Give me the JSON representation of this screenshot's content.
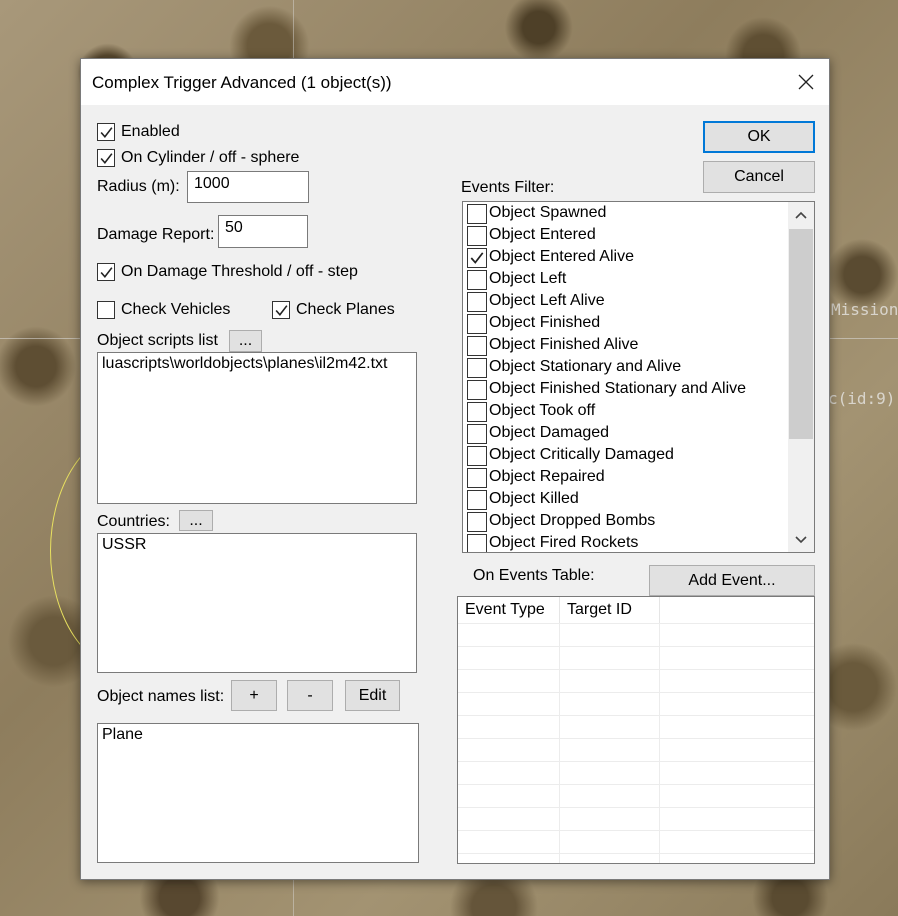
{
  "map": {
    "label_mission": "Mission",
    "label_id": "c(id:9)"
  },
  "dialog": {
    "title": "Complex Trigger Advanced (1 object(s))",
    "enabled": {
      "label": "Enabled",
      "checked": true
    },
    "on_cylinder": {
      "label": "On Cylinder / off - sphere",
      "checked": true
    },
    "radius": {
      "label": "Radius (m):",
      "value": "1000"
    },
    "damage_report": {
      "label": "Damage Report:",
      "value": "50"
    },
    "on_damage_threshold": {
      "label": "On Damage Threshold / off - step",
      "checked": true
    },
    "check_vehicles": {
      "label": "Check Vehicles",
      "checked": false
    },
    "check_planes": {
      "label": "Check Planes",
      "checked": true
    },
    "object_scripts": {
      "label": "Object scripts list",
      "button": "...",
      "items": [
        "luascripts\\worldobjects\\planes\\il2m42.txt"
      ]
    },
    "countries": {
      "label": "Countries:",
      "button": "...",
      "items": [
        "USSR"
      ]
    },
    "object_names": {
      "label": "Object names list:",
      "add_button": "+",
      "remove_button": "-",
      "edit_button": "Edit",
      "items": [
        "Plane"
      ]
    },
    "ok_button": "OK",
    "cancel_button": "Cancel",
    "events_filter": {
      "label": "Events Filter:",
      "items": [
        {
          "label": "Object Spawned",
          "checked": false
        },
        {
          "label": "Object Entered",
          "checked": false
        },
        {
          "label": "Object Entered Alive",
          "checked": true
        },
        {
          "label": "Object Left",
          "checked": false
        },
        {
          "label": "Object Left Alive",
          "checked": false
        },
        {
          "label": "Object Finished",
          "checked": false
        },
        {
          "label": "Object Finished Alive",
          "checked": false
        },
        {
          "label": "Object Stationary and Alive",
          "checked": false
        },
        {
          "label": "Object Finished Stationary and Alive",
          "checked": false
        },
        {
          "label": "Object Took off",
          "checked": false
        },
        {
          "label": "Object Damaged",
          "checked": false
        },
        {
          "label": "Object Critically Damaged",
          "checked": false
        },
        {
          "label": "Object Repaired",
          "checked": false
        },
        {
          "label": "Object Killed",
          "checked": false
        },
        {
          "label": "Object Dropped Bombs",
          "checked": false
        },
        {
          "label": "Object Fired Rockets",
          "checked": false
        }
      ]
    },
    "on_events_table": {
      "label": "On Events Table:",
      "add_button": "Add Event...",
      "columns": [
        "Event Type",
        "Target ID"
      ],
      "rows": []
    }
  }
}
